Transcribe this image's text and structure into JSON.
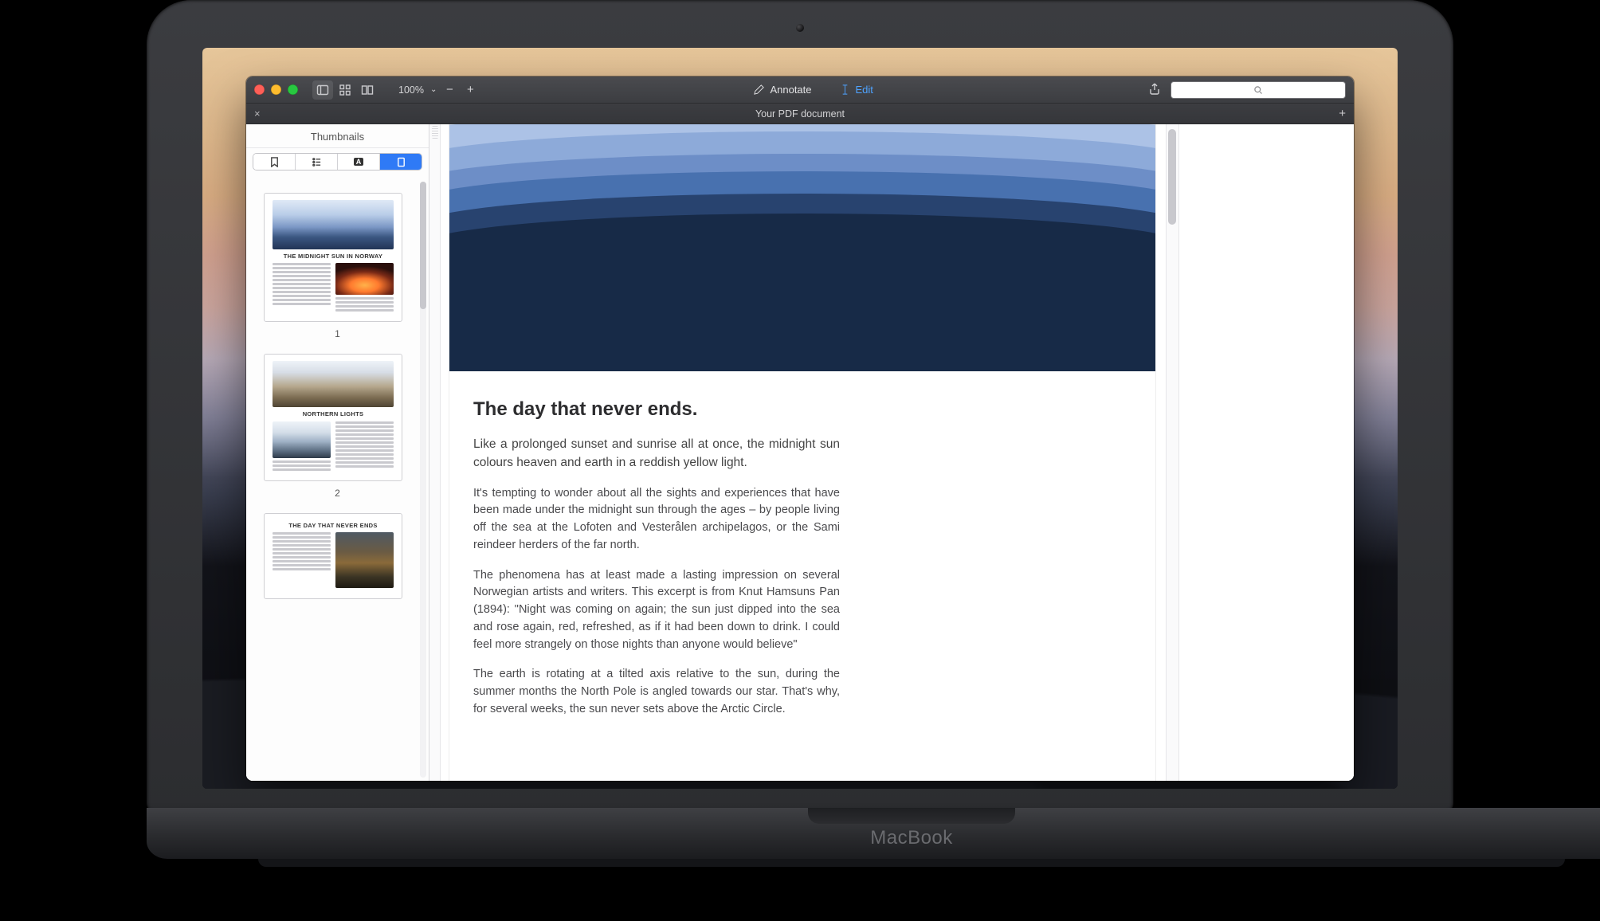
{
  "device": {
    "brand": "MacBook"
  },
  "toolbar": {
    "zoom_level": "100%",
    "annotate_label": "Annotate",
    "edit_label": "Edit",
    "search_placeholder": ""
  },
  "tab": {
    "title": "Your PDF document"
  },
  "sidebar": {
    "title": "Thumbnails",
    "segments": [
      "bookmarks",
      "outline",
      "annotations",
      "thumbnails"
    ],
    "active_segment": "thumbnails",
    "thumbnails": [
      {
        "page": "1",
        "title": "THE MIDNIGHT SUN IN NORWAY"
      },
      {
        "page": "2",
        "title": "NORTHERN LIGHTS"
      },
      {
        "page": "",
        "title": "THE DAY THAT NEVER ENDS"
      }
    ]
  },
  "document": {
    "heading": "The day that never ends.",
    "paragraphs": [
      "Like a prolonged sunset and sunrise all at once, the midnight sun colours heaven and earth in a reddish yellow light.",
      "It's tempting to wonder about all the sights and experiences that have been made under the midnight sun through the ages – by people living off the sea at the Lofoten and Vesterålen archipelagos, or the Sami reindeer herders of the far north.",
      "The phenomena has at least made a lasting impression on several Norwegian artists and writers. This excerpt is from Knut Hamsuns Pan (1894): \"Night was coming on again; the sun just dipped into the sea and rose again, red, refreshed, as if it had been down to drink. I could feel more strangely on those nights than anyone would believe\"",
      "The earth is rotating at a tilted axis relative to the sun, during the summer months the North Pole is angled towards our star. That's why, for several weeks, the sun never sets above the Arctic Circle."
    ]
  }
}
